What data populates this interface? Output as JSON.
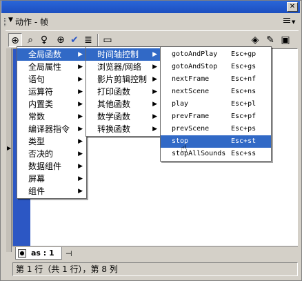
{
  "window": {
    "close_icon": "close-icon"
  },
  "panel": {
    "title_prefix": "▼",
    "title": "动作 - 帧"
  },
  "toolbar": {
    "buttons": [
      "add-item",
      "find",
      "replace",
      "target-path",
      "check-syntax",
      "auto-format",
      "show-code-hint"
    ],
    "right_buttons": [
      "debug-options",
      "reference",
      "view-options"
    ]
  },
  "menu_level1": {
    "items": [
      {
        "label": "全局函数",
        "has_sub": true,
        "highlighted": true
      },
      {
        "label": "全局属性",
        "has_sub": true
      },
      {
        "label": "语句",
        "has_sub": true
      },
      {
        "label": "运算符",
        "has_sub": true
      },
      {
        "label": "内置类",
        "has_sub": true
      },
      {
        "label": "常数",
        "has_sub": true
      },
      {
        "label": "编译器指令",
        "has_sub": true
      },
      {
        "label": "类型",
        "has_sub": true
      },
      {
        "label": "否决的",
        "has_sub": true
      },
      {
        "label": "数据组件",
        "has_sub": true
      },
      {
        "label": "屏幕",
        "has_sub": true
      },
      {
        "label": "组件",
        "has_sub": true
      }
    ]
  },
  "menu_level2": {
    "items": [
      {
        "label": "时间轴控制",
        "has_sub": true,
        "highlighted": true
      },
      {
        "label": "浏览器/网络",
        "has_sub": true
      },
      {
        "label": "影片剪辑控制",
        "has_sub": true
      },
      {
        "label": "打印函数",
        "has_sub": true
      },
      {
        "label": "其他函数",
        "has_sub": true
      },
      {
        "label": "数学函数",
        "has_sub": true
      },
      {
        "label": "转换函数",
        "has_sub": true
      }
    ]
  },
  "menu_level3": {
    "items": [
      {
        "label": "gotoAndPlay",
        "shortcut": "Esc+gp"
      },
      {
        "label": "gotoAndStop",
        "shortcut": "Esc+gs"
      },
      {
        "label": "nextFrame",
        "shortcut": "Esc+nf"
      },
      {
        "label": "nextScene",
        "shortcut": "Esc+ns"
      },
      {
        "label": "play",
        "shortcut": "Esc+pl"
      },
      {
        "label": "prevFrame",
        "shortcut": "Esc+pf"
      },
      {
        "label": "prevScene",
        "shortcut": "Esc+ps"
      },
      {
        "label": "stop",
        "shortcut": "Esc+st",
        "highlighted": true
      },
      {
        "label": "stopAllSounds",
        "shortcut": "Esc+ss"
      }
    ]
  },
  "tabs": {
    "script_tab": "as : 1"
  },
  "status": {
    "text": "第 1 行（共 1 行），第 8 列"
  },
  "colors": {
    "accent": "#3169c6",
    "gutter": "#2c57c4",
    "titlebar": "#1c4fc0"
  }
}
